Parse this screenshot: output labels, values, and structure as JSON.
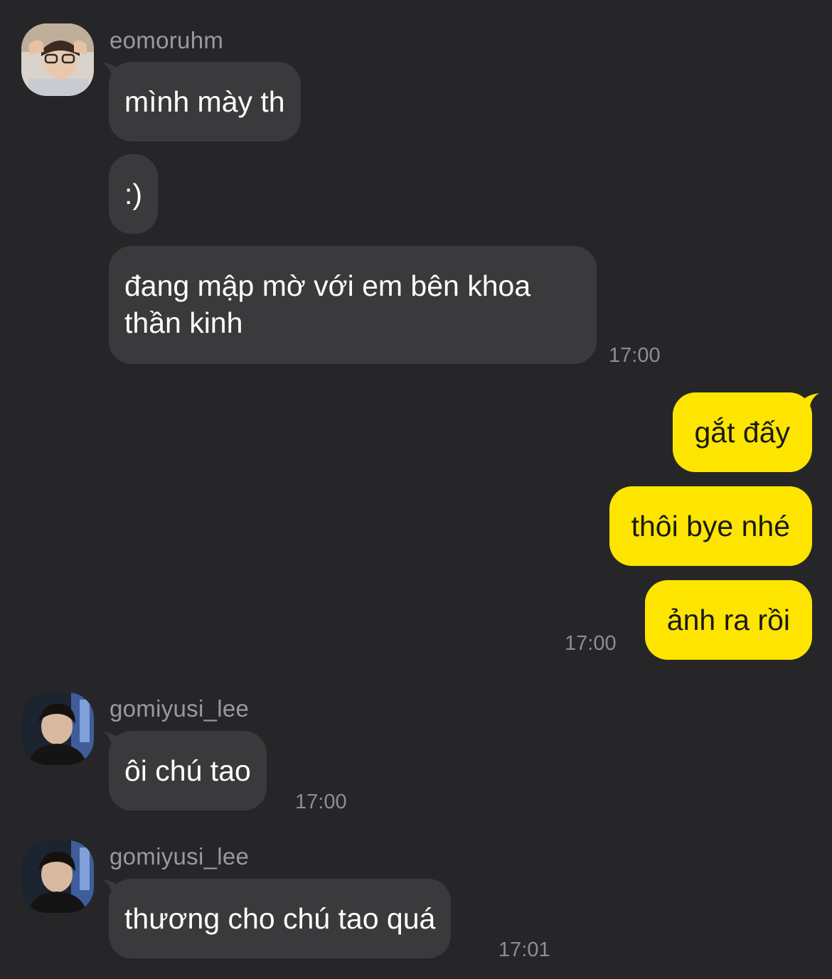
{
  "colors": {
    "background": "#262628",
    "incoming_bubble": "#3a3a3c",
    "outgoing_bubble": "#fee500",
    "sender_text": "#9a9a9e",
    "timestamp": "#8e8e93"
  },
  "messages": {
    "group1": {
      "sender": "eomoruhm",
      "avatar_icon": "user-avatar-icon",
      "bubbles": [
        "mình mày th",
        ":)",
        "đang mập mờ với em bên khoa thần kinh"
      ],
      "time": "17:00"
    },
    "group2": {
      "bubbles": [
        "gắt đấy",
        "thôi bye nhé",
        "ảnh ra rồi"
      ],
      "time": "17:00"
    },
    "group3": {
      "sender": "gomiyusi_lee",
      "avatar_icon": "user-avatar-icon",
      "bubbles": [
        "ôi chú tao"
      ],
      "time": "17:00"
    },
    "group4": {
      "sender": "gomiyusi_lee",
      "avatar_icon": "user-avatar-icon",
      "bubbles": [
        "thương cho chú tao quá"
      ],
      "time": "17:01"
    }
  }
}
